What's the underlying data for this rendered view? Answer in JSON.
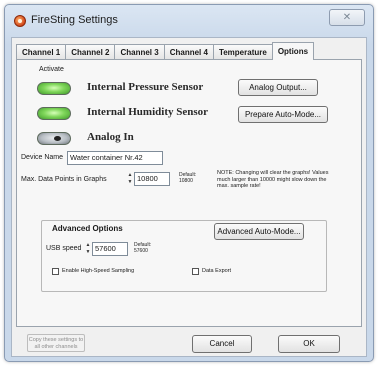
{
  "window": {
    "title": "FireSting Settings",
    "close_glyph": "✕",
    "icon": "firesting-app-icon"
  },
  "tabs": [
    {
      "label": "Channel 1",
      "active": false
    },
    {
      "label": "Channel 2",
      "active": false
    },
    {
      "label": "Channel 3",
      "active": false
    },
    {
      "label": "Channel 4",
      "active": false
    },
    {
      "label": "Temperature",
      "active": false
    },
    {
      "label": "Options",
      "active": true
    }
  ],
  "options": {
    "activate_label": "Activate",
    "sensors": [
      {
        "label": "Internal Pressure Sensor",
        "active": true
      },
      {
        "label": "Internal Humidity Sensor",
        "active": true
      },
      {
        "label": "Analog In",
        "active": false
      }
    ],
    "analog_output_button": "Analog Output...",
    "prepare_auto_mode_button": "Prepare Auto-Mode...",
    "device_name_label": "Device Name",
    "device_name_value": "Water container Nr.42",
    "max_points_label": "Max. Data Points in Graphs",
    "max_points_value": "10800",
    "max_points_default_label": "Default:",
    "max_points_default_value": "10800",
    "note_text": "NOTE: Changing will clear the graphs! Values much larger than 10000 might slow down the max. sample rate!"
  },
  "advanced": {
    "title": "Advanced Options",
    "auto_mode_button": "Advanced Auto-Mode...",
    "usb_speed_label": "USB speed",
    "usb_speed_value": "57600",
    "usb_default_label": "Default:",
    "usb_default_value": "57600",
    "high_speed_label": "Enable High-Speed Sampling",
    "high_speed_checked": false,
    "data_export_label": "Data Export",
    "data_export_checked": false
  },
  "footer": {
    "copy_button": "Copy these settings to all other channels",
    "cancel_button": "Cancel",
    "ok_button": "OK"
  },
  "colors": {
    "led_on": "#7fd65a",
    "led_off": "#b8bec4",
    "window_frame": "#c9d8ea"
  }
}
